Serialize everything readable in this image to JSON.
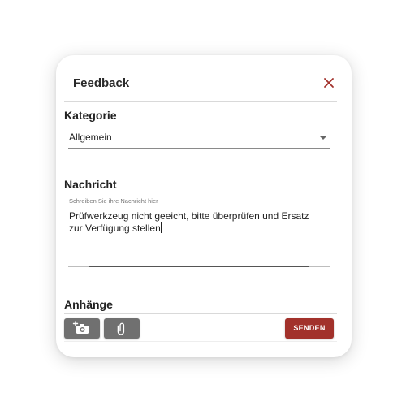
{
  "dialog": {
    "title": "Feedback",
    "close_icon": "close-icon",
    "accent_color": "#a2312b"
  },
  "category": {
    "label": "Kategorie",
    "selected": "Allgemein"
  },
  "message": {
    "label": "Nachricht",
    "placeholder": "Schreiben Sie ihre Nachricht hier",
    "value": "Prüfwerkzeug nicht geeicht, bitte überprüfen und Ersatz zur Verfügung stellen"
  },
  "attachments": {
    "label": "Anhänge",
    "camera_icon": "add-photo-icon",
    "file_icon": "paperclip-icon",
    "send_label": "SENDEN"
  }
}
